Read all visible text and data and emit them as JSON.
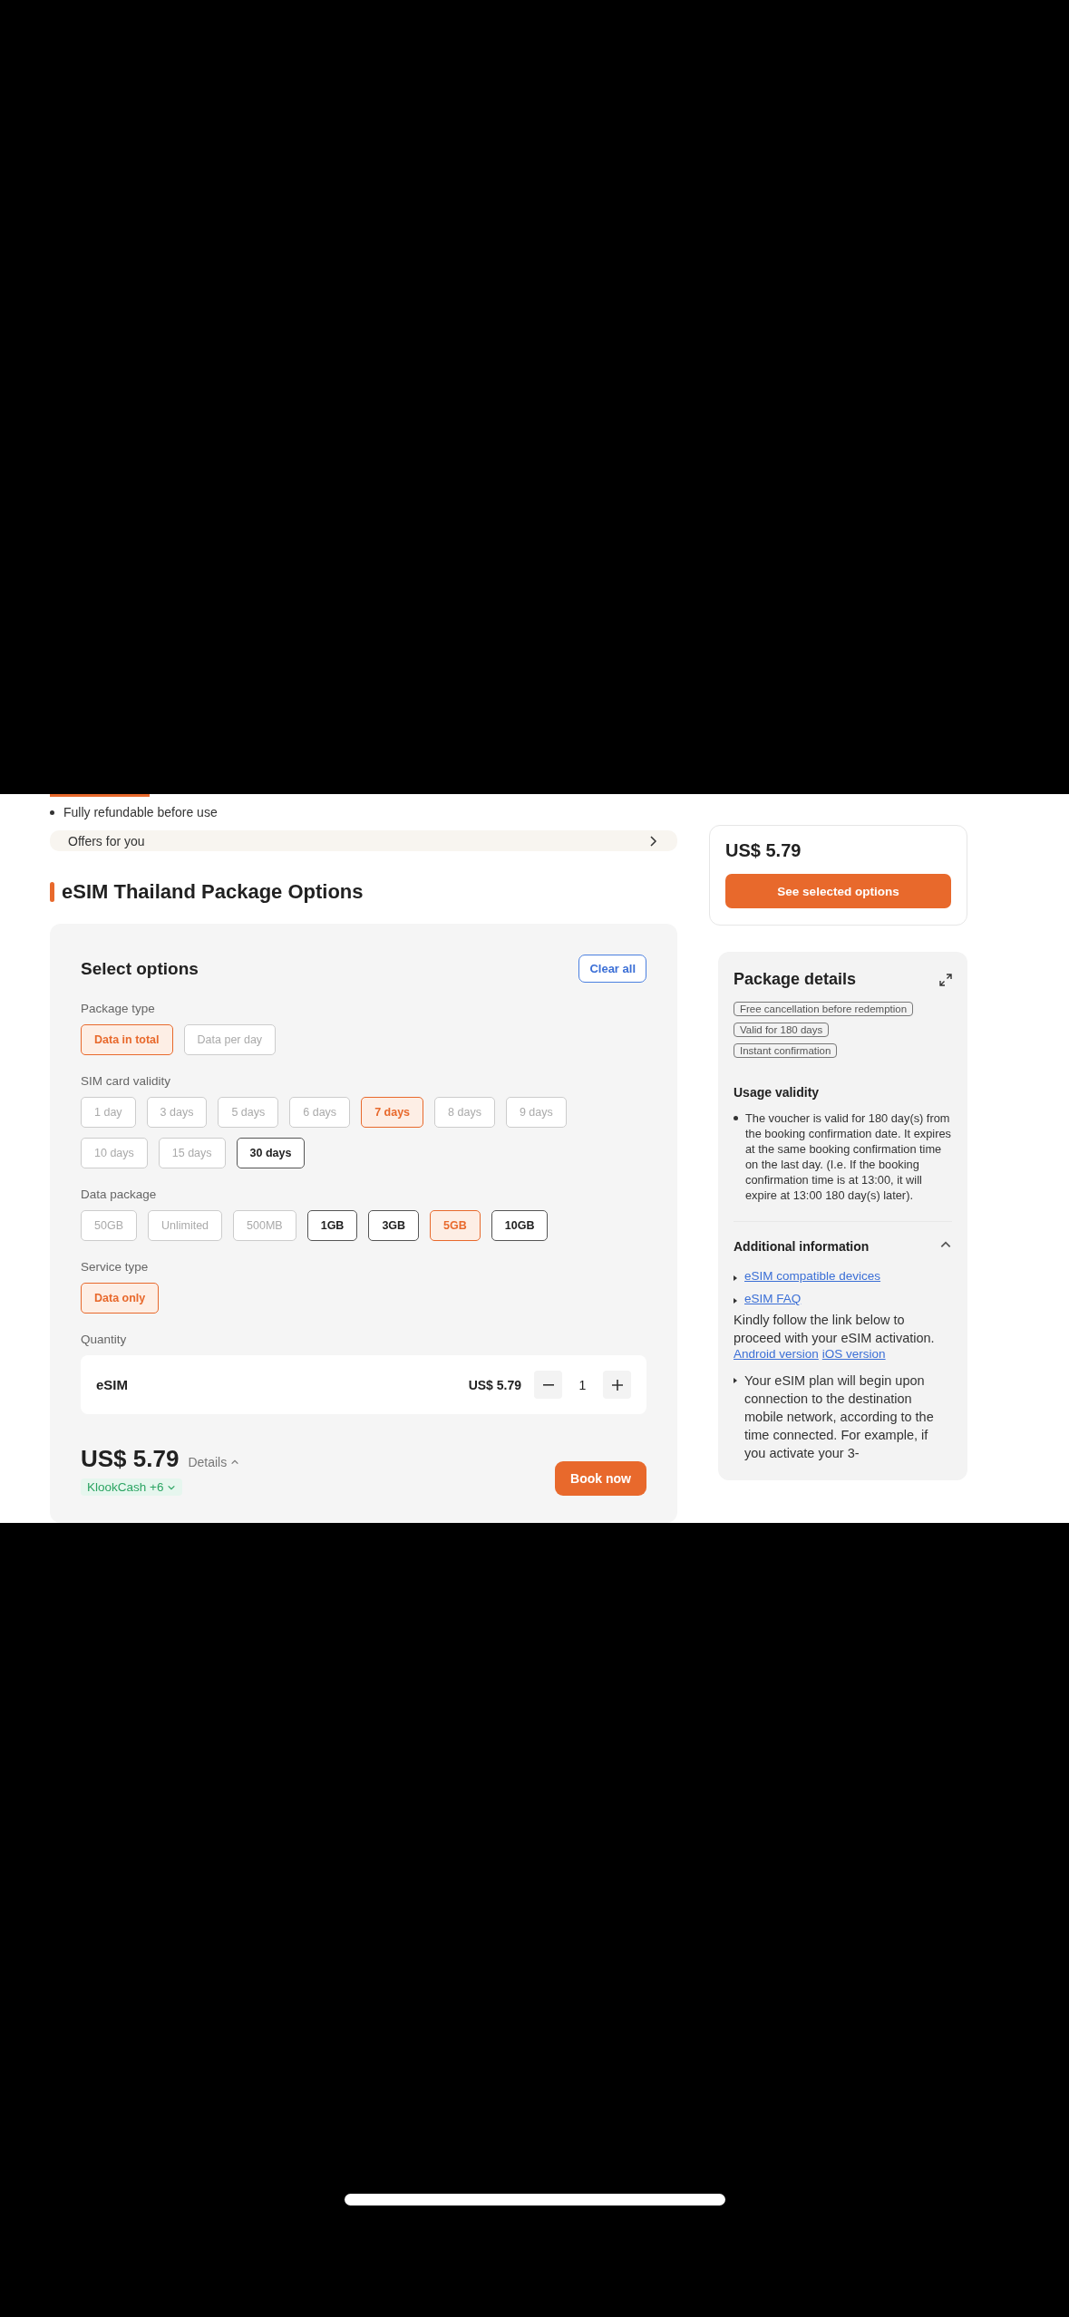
{
  "highlights": [
    "Fully refundable before use"
  ],
  "offers": {
    "label": "Offers for you"
  },
  "section_title": "eSIM Thailand Package Options",
  "options": {
    "title": "Select options",
    "clear_button": "Clear all",
    "groups": [
      {
        "label": "Package type",
        "choices": [
          {
            "label": "Data in total",
            "selected": true,
            "disabled": false
          },
          {
            "label": "Data per day",
            "selected": false,
            "disabled": true
          }
        ]
      },
      {
        "label": "SIM card validity",
        "choices": [
          {
            "label": "1 day",
            "selected": false,
            "disabled": true
          },
          {
            "label": "3 days",
            "selected": false,
            "disabled": true
          },
          {
            "label": "5 days",
            "selected": false,
            "disabled": true
          },
          {
            "label": "6 days",
            "selected": false,
            "disabled": true
          },
          {
            "label": "7 days",
            "selected": true,
            "disabled": false
          },
          {
            "label": "8 days",
            "selected": false,
            "disabled": true
          },
          {
            "label": "9 days",
            "selected": false,
            "disabled": true
          },
          {
            "label": "10 days",
            "selected": false,
            "disabled": true
          },
          {
            "label": "15 days",
            "selected": false,
            "disabled": true
          },
          {
            "label": "30 days",
            "selected": false,
            "disabled": false
          }
        ]
      },
      {
        "label": "Data package",
        "choices": [
          {
            "label": "50GB",
            "selected": false,
            "disabled": true
          },
          {
            "label": "Unlimited",
            "selected": false,
            "disabled": true
          },
          {
            "label": "500MB",
            "selected": false,
            "disabled": true
          },
          {
            "label": "1GB",
            "selected": false,
            "disabled": false
          },
          {
            "label": "3GB",
            "selected": false,
            "disabled": false
          },
          {
            "label": "5GB",
            "selected": true,
            "disabled": false
          },
          {
            "label": "10GB",
            "selected": false,
            "disabled": false
          }
        ]
      },
      {
        "label": "Service type",
        "choices": [
          {
            "label": "Data only",
            "selected": true,
            "disabled": false
          }
        ]
      }
    ]
  },
  "quantity": {
    "label": "Quantity",
    "item": "eSIM",
    "price": "US$ 5.79",
    "value": "1"
  },
  "total": {
    "price": "US$ 5.79",
    "details": "Details",
    "cashback": "KlookCash +6",
    "book_button": "Book now"
  },
  "price_card": {
    "price": "US$ 5.79",
    "button": "See selected options"
  },
  "package_details": {
    "title": "Package details",
    "tags": [
      "Free cancellation before redemption",
      "Valid for 180 days",
      "Instant confirmation"
    ],
    "usage_title": "Usage validity",
    "usage_items": [
      "The voucher is valid for 180 day(s) from the booking confirmation date. It expires at the same booking confirmation time on the last day. (I.e. If the booking confirmation time is at 13:00, it will expire at 13:00 180 day(s) later)."
    ],
    "additional_title": "Additional information",
    "expanded": true,
    "links": [
      "eSIM compatible devices",
      "eSIM FAQ"
    ],
    "activation_text": "Kindly follow the link below to proceed with your eSIM activation.",
    "activation_links": [
      "Android version",
      "iOS version"
    ],
    "notes": [
      "Your eSIM plan will begin upon connection to the destination mobile network, according to the time connected. For example, if you activate your 3-"
    ]
  }
}
